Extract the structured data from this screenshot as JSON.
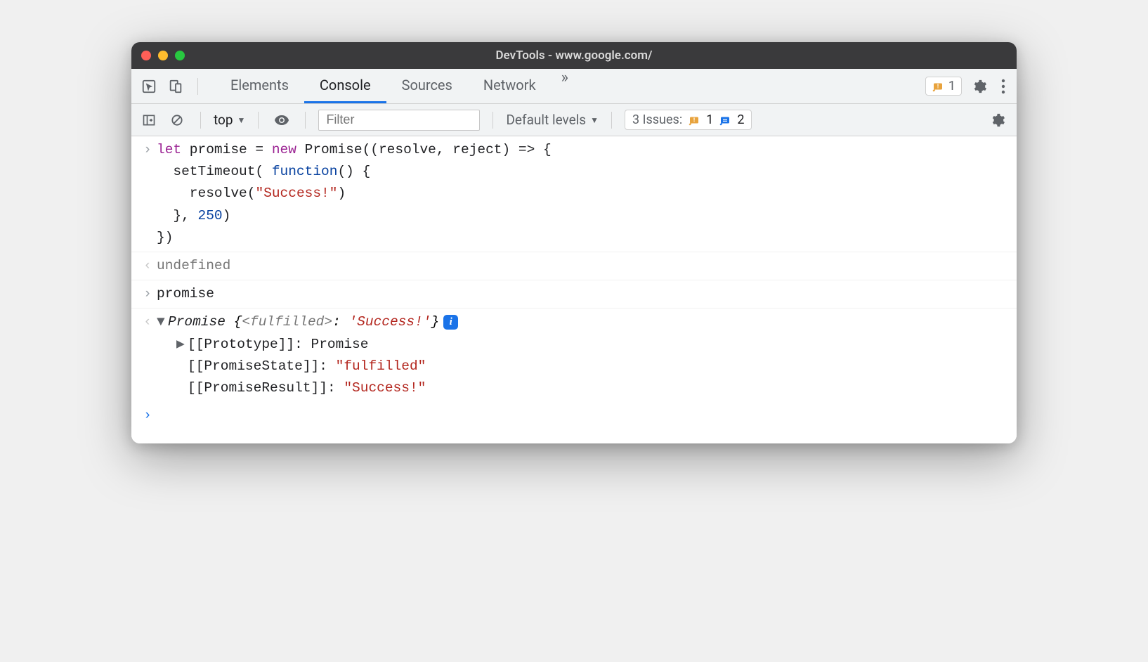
{
  "window": {
    "title": "DevTools - www.google.com/"
  },
  "tabs": {
    "elements": "Elements",
    "console": "Console",
    "sources": "Sources",
    "network": "Network",
    "more": "»"
  },
  "tabstrip": {
    "warn_count": "1"
  },
  "toolbar": {
    "context": "top",
    "filter_placeholder": "Filter",
    "levels": "Default levels",
    "issues_label": "3 Issues:",
    "issues_warn": "1",
    "issues_info": "2"
  },
  "console": {
    "code": {
      "l1a": "let",
      "l1b": " promise = ",
      "l1c": "new",
      "l1d": " Promise((resolve, reject) => {",
      "l2a": "  setTimeout( ",
      "l2b": "function",
      "l2c": "() {",
      "l3a": "    resolve(",
      "l3b": "\"Success!\"",
      "l3c": ")",
      "l4a": "  }, ",
      "l4b": "250",
      "l4c": ")",
      "l5": "})"
    },
    "result1": "undefined",
    "input2": "promise",
    "obj": {
      "head_a": "Promise ",
      "head_b": "{",
      "head_c": "<fulfilled>",
      "head_d": ": ",
      "head_e": "'Success!'",
      "head_f": "}",
      "p1k": "[[Prototype]]",
      "p1v": ": Promise",
      "p2k": "[[PromiseState]]",
      "p2v": ": ",
      "p2s": "\"fulfilled\"",
      "p3k": "[[PromiseResult]]",
      "p3v": ": ",
      "p3s": "\"Success!\""
    },
    "info_badge": "i"
  }
}
